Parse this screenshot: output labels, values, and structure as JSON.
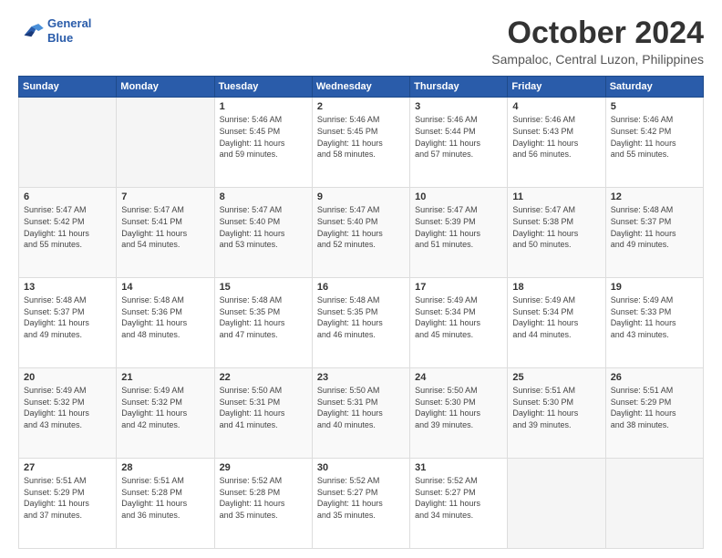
{
  "header": {
    "logo_line1": "General",
    "logo_line2": "Blue",
    "month": "October 2024",
    "location": "Sampaloc, Central Luzon, Philippines"
  },
  "weekdays": [
    "Sunday",
    "Monday",
    "Tuesday",
    "Wednesday",
    "Thursday",
    "Friday",
    "Saturday"
  ],
  "weeks": [
    [
      {
        "day": "",
        "info": ""
      },
      {
        "day": "",
        "info": ""
      },
      {
        "day": "1",
        "info": "Sunrise: 5:46 AM\nSunset: 5:45 PM\nDaylight: 11 hours\nand 59 minutes."
      },
      {
        "day": "2",
        "info": "Sunrise: 5:46 AM\nSunset: 5:45 PM\nDaylight: 11 hours\nand 58 minutes."
      },
      {
        "day": "3",
        "info": "Sunrise: 5:46 AM\nSunset: 5:44 PM\nDaylight: 11 hours\nand 57 minutes."
      },
      {
        "day": "4",
        "info": "Sunrise: 5:46 AM\nSunset: 5:43 PM\nDaylight: 11 hours\nand 56 minutes."
      },
      {
        "day": "5",
        "info": "Sunrise: 5:46 AM\nSunset: 5:42 PM\nDaylight: 11 hours\nand 55 minutes."
      }
    ],
    [
      {
        "day": "6",
        "info": "Sunrise: 5:47 AM\nSunset: 5:42 PM\nDaylight: 11 hours\nand 55 minutes."
      },
      {
        "day": "7",
        "info": "Sunrise: 5:47 AM\nSunset: 5:41 PM\nDaylight: 11 hours\nand 54 minutes."
      },
      {
        "day": "8",
        "info": "Sunrise: 5:47 AM\nSunset: 5:40 PM\nDaylight: 11 hours\nand 53 minutes."
      },
      {
        "day": "9",
        "info": "Sunrise: 5:47 AM\nSunset: 5:40 PM\nDaylight: 11 hours\nand 52 minutes."
      },
      {
        "day": "10",
        "info": "Sunrise: 5:47 AM\nSunset: 5:39 PM\nDaylight: 11 hours\nand 51 minutes."
      },
      {
        "day": "11",
        "info": "Sunrise: 5:47 AM\nSunset: 5:38 PM\nDaylight: 11 hours\nand 50 minutes."
      },
      {
        "day": "12",
        "info": "Sunrise: 5:48 AM\nSunset: 5:37 PM\nDaylight: 11 hours\nand 49 minutes."
      }
    ],
    [
      {
        "day": "13",
        "info": "Sunrise: 5:48 AM\nSunset: 5:37 PM\nDaylight: 11 hours\nand 49 minutes."
      },
      {
        "day": "14",
        "info": "Sunrise: 5:48 AM\nSunset: 5:36 PM\nDaylight: 11 hours\nand 48 minutes."
      },
      {
        "day": "15",
        "info": "Sunrise: 5:48 AM\nSunset: 5:35 PM\nDaylight: 11 hours\nand 47 minutes."
      },
      {
        "day": "16",
        "info": "Sunrise: 5:48 AM\nSunset: 5:35 PM\nDaylight: 11 hours\nand 46 minutes."
      },
      {
        "day": "17",
        "info": "Sunrise: 5:49 AM\nSunset: 5:34 PM\nDaylight: 11 hours\nand 45 minutes."
      },
      {
        "day": "18",
        "info": "Sunrise: 5:49 AM\nSunset: 5:34 PM\nDaylight: 11 hours\nand 44 minutes."
      },
      {
        "day": "19",
        "info": "Sunrise: 5:49 AM\nSunset: 5:33 PM\nDaylight: 11 hours\nand 43 minutes."
      }
    ],
    [
      {
        "day": "20",
        "info": "Sunrise: 5:49 AM\nSunset: 5:32 PM\nDaylight: 11 hours\nand 43 minutes."
      },
      {
        "day": "21",
        "info": "Sunrise: 5:49 AM\nSunset: 5:32 PM\nDaylight: 11 hours\nand 42 minutes."
      },
      {
        "day": "22",
        "info": "Sunrise: 5:50 AM\nSunset: 5:31 PM\nDaylight: 11 hours\nand 41 minutes."
      },
      {
        "day": "23",
        "info": "Sunrise: 5:50 AM\nSunset: 5:31 PM\nDaylight: 11 hours\nand 40 minutes."
      },
      {
        "day": "24",
        "info": "Sunrise: 5:50 AM\nSunset: 5:30 PM\nDaylight: 11 hours\nand 39 minutes."
      },
      {
        "day": "25",
        "info": "Sunrise: 5:51 AM\nSunset: 5:30 PM\nDaylight: 11 hours\nand 39 minutes."
      },
      {
        "day": "26",
        "info": "Sunrise: 5:51 AM\nSunset: 5:29 PM\nDaylight: 11 hours\nand 38 minutes."
      }
    ],
    [
      {
        "day": "27",
        "info": "Sunrise: 5:51 AM\nSunset: 5:29 PM\nDaylight: 11 hours\nand 37 minutes."
      },
      {
        "day": "28",
        "info": "Sunrise: 5:51 AM\nSunset: 5:28 PM\nDaylight: 11 hours\nand 36 minutes."
      },
      {
        "day": "29",
        "info": "Sunrise: 5:52 AM\nSunset: 5:28 PM\nDaylight: 11 hours\nand 35 minutes."
      },
      {
        "day": "30",
        "info": "Sunrise: 5:52 AM\nSunset: 5:27 PM\nDaylight: 11 hours\nand 35 minutes."
      },
      {
        "day": "31",
        "info": "Sunrise: 5:52 AM\nSunset: 5:27 PM\nDaylight: 11 hours\nand 34 minutes."
      },
      {
        "day": "",
        "info": ""
      },
      {
        "day": "",
        "info": ""
      }
    ]
  ]
}
